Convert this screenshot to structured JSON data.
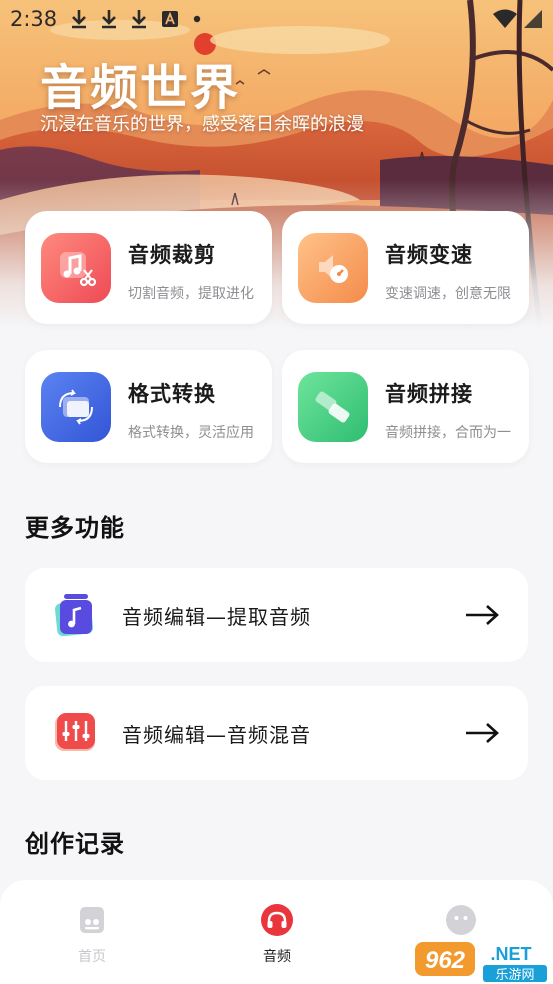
{
  "status_bar": {
    "time": "2:38",
    "icons": [
      "download-icon",
      "download-icon",
      "download-icon",
      "font-a-icon",
      "dot-icon"
    ],
    "right_icons": [
      "wifi-icon",
      "signal-icon"
    ]
  },
  "hero": {
    "title": "音频世界",
    "subtitle": "沉浸在音乐的世界，感受落日余晖的浪漫"
  },
  "features": [
    {
      "title": "音频裁剪",
      "subtitle": "切割音频，提取进化",
      "icon": "audio-cut-icon",
      "color": "#f2585a"
    },
    {
      "title": "音频变速",
      "subtitle": "变速调速，创意无限",
      "icon": "speed-change-icon",
      "color": "#f59a56"
    },
    {
      "title": "格式转换",
      "subtitle": "格式转换，灵活应用",
      "icon": "format-convert-icon",
      "color": "#4065e3"
    },
    {
      "title": "音频拼接",
      "subtitle": "音频拼接，合而为一",
      "icon": "audio-merge-icon",
      "color": "#35c77c"
    }
  ],
  "more": {
    "title": "更多功能",
    "items": [
      {
        "label": "音频编辑—提取音频",
        "icon": "extract-audio-icon"
      },
      {
        "label": "音频编辑—音频混音",
        "icon": "mixer-icon"
      }
    ]
  },
  "records": {
    "title": "创作记录"
  },
  "nav": [
    {
      "label": "首页",
      "icon": "home-icon",
      "active": false
    },
    {
      "label": "音频",
      "icon": "headphones-icon",
      "active": true
    },
    {
      "label": "",
      "icon": "profile-icon",
      "active": false
    }
  ],
  "watermark": {
    "text": "962.NET",
    "sub": "乐游网"
  },
  "colors": {
    "accent": "#e8363c",
    "background": "#f6f6f8",
    "inactive_nav": "#c8c8cc"
  }
}
